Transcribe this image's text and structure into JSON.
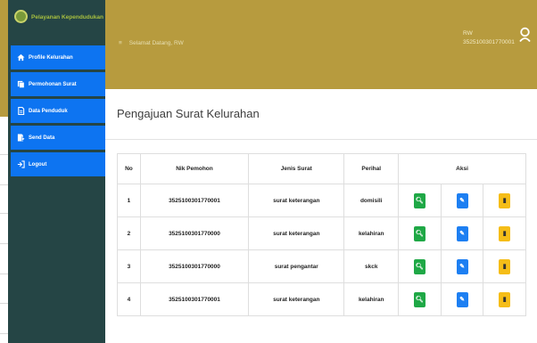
{
  "app": {
    "brand": "Pelayanan Kependudukan"
  },
  "header": {
    "welcome": "Selamat Datang, RW",
    "menu_icon": "hamburger-icon"
  },
  "user": {
    "role": "RW",
    "id": "3525100301770001"
  },
  "sidebar": {
    "items": [
      {
        "label": "Profile Kelurahan",
        "icon": "home-icon"
      },
      {
        "label": "Permohonan Surat",
        "icon": "documents-icon"
      },
      {
        "label": "Data Penduduk",
        "icon": "file-icon"
      },
      {
        "label": "Send Data",
        "icon": "send-file-icon"
      },
      {
        "label": "Logout",
        "icon": "logout-icon"
      }
    ]
  },
  "main": {
    "title": "Pengajuan Surat Kelurahan",
    "table": {
      "headers": [
        "No",
        "Nik Pemohon",
        "Jenis Surat",
        "Perihal",
        "Aksi"
      ],
      "rows": [
        {
          "no": "1",
          "nik": "3525100301770001",
          "jenis": "surat keterangan",
          "perihal": "domisili"
        },
        {
          "no": "2",
          "nik": "3525100301770000",
          "jenis": "surat keterangan",
          "perihal": "kelahiran"
        },
        {
          "no": "3",
          "nik": "3525100301770000",
          "jenis": "surat pengantar",
          "perihal": "skck"
        },
        {
          "no": "4",
          "nik": "3525100301770001",
          "jenis": "surat keterangan",
          "perihal": "kelahiran"
        }
      ]
    },
    "actions": {
      "view_icon": "search-icon",
      "edit_icon": "edit-icon",
      "delete_icon": "trash-icon"
    }
  },
  "colors": {
    "topbar": "#b79b3e",
    "sidebar": "#254545",
    "menu": "#0d74f1",
    "view": "#1fa846",
    "edit": "#1d7ff2",
    "delete": "#f5bd18"
  }
}
